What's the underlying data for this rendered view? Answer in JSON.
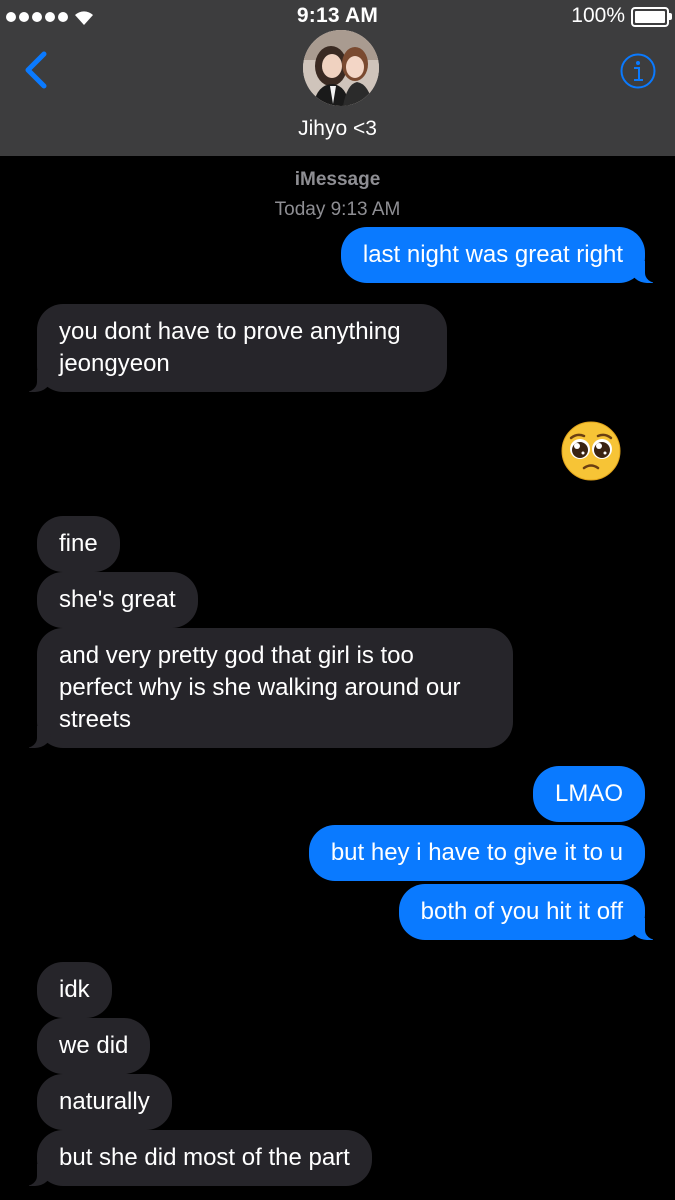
{
  "status_bar": {
    "time": "9:13 AM",
    "battery": "100%"
  },
  "header": {
    "contact_name": "Jihyo <3"
  },
  "thread": {
    "service": "iMessage",
    "timestamp": "Today 9:13 AM"
  },
  "messages": [
    {
      "dir": "out",
      "text": "last night was great right"
    },
    {
      "dir": "in",
      "lines": [
        "you dont have to prove anything",
        "jeongyeon"
      ]
    },
    {
      "dir": "in",
      "emoji": "pleading-face"
    },
    {
      "dir": "in",
      "text": "fine"
    },
    {
      "dir": "in",
      "text": "she's great"
    },
    {
      "dir": "in",
      "lines": [
        "and very pretty god that girl is too",
        "perfect why is she walking around our",
        "streets"
      ]
    },
    {
      "dir": "out",
      "text": "LMAO"
    },
    {
      "dir": "out",
      "text": "but hey i have to give it to u"
    },
    {
      "dir": "out",
      "text": "both of you hit it off"
    },
    {
      "dir": "in",
      "text": "idk"
    },
    {
      "dir": "in",
      "text": "we did"
    },
    {
      "dir": "in",
      "text": "naturally"
    },
    {
      "dir": "in",
      "text": "but she did most of the part"
    }
  ],
  "colors": {
    "outgoing": "#0a7aff",
    "incoming": "#26252a",
    "header": "#3d3d3e",
    "accent": "#0a7aff"
  },
  "icons": [
    "signal-icon",
    "wifi-icon",
    "battery-icon",
    "back-chevron-icon",
    "info-icon"
  ]
}
